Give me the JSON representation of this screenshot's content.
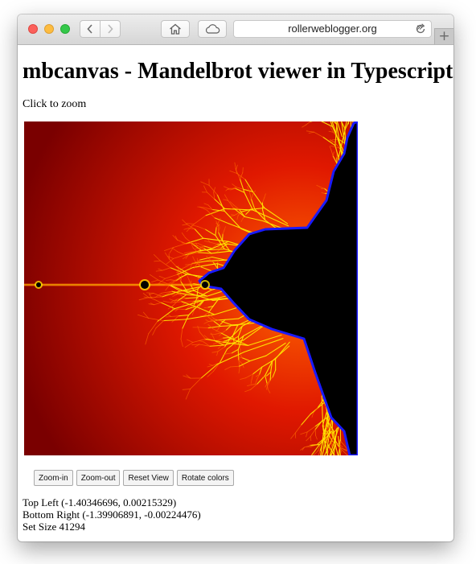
{
  "browser": {
    "url": "rollerweblogger.org",
    "overflow_glyph": "»",
    "newtab_glyph": "+"
  },
  "page": {
    "title": "mbcanvas - Mandelbrot viewer in Typescript",
    "instruction": "Click to zoom"
  },
  "controls": {
    "zoom_in": "Zoom-in",
    "zoom_out": "Zoom-out",
    "reset_view": "Reset View",
    "rotate_colors": "Rotate colors"
  },
  "info": {
    "top_left": "Top Left (-1.40346696, 0.00215329)",
    "bottom_right": "Bottom Right (-1.39906891, -0.00224476)",
    "set_size": "Set Size 41294"
  },
  "colors": {
    "set_interior": "#000000",
    "outer": "#7a0000",
    "band_mid": "#e01800",
    "band_edge": "#ff6a00",
    "filament": "#ffe000",
    "boundary": "#1a1aff"
  }
}
